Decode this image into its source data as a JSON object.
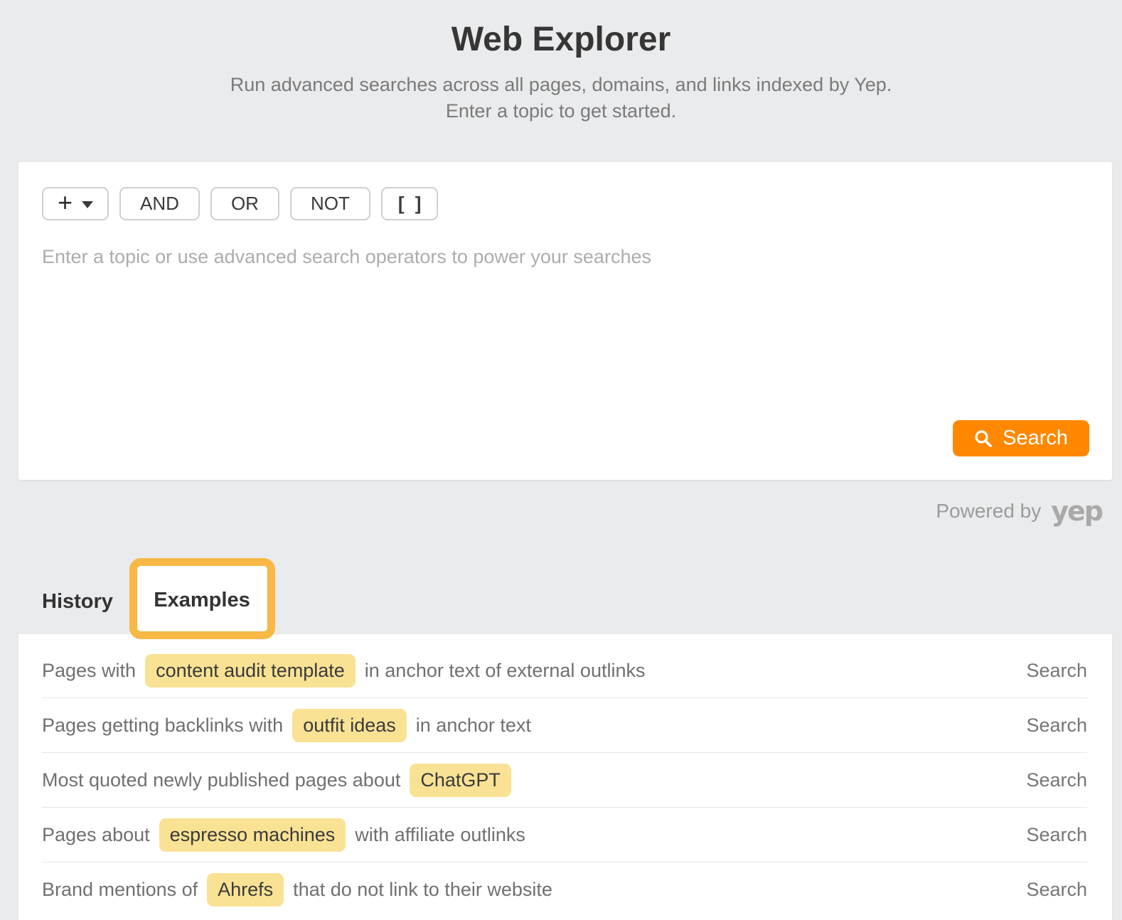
{
  "header": {
    "title": "Web Explorer",
    "subtitle_line1": "Run advanced searches across all pages, domains, and links indexed by Yep.",
    "subtitle_line2": "Enter a topic to get started."
  },
  "query_builder": {
    "add_button_label": "+",
    "operator_buttons": [
      {
        "label": "AND"
      },
      {
        "label": "OR"
      },
      {
        "label": "NOT"
      },
      {
        "label": "[ ]"
      }
    ],
    "input_placeholder": "Enter a topic or use advanced search operators to power your searches",
    "input_value": "",
    "search_button_label": "Search"
  },
  "powered_by": {
    "text": "Powered by",
    "brand": "yep"
  },
  "tabs": [
    {
      "label": "History",
      "active": false
    },
    {
      "label": "Examples",
      "active": true
    }
  ],
  "examples": {
    "rows": [
      {
        "prefix": "Pages with",
        "highlight": "content audit template",
        "suffix": "in anchor text of external outlinks",
        "action": "Search"
      },
      {
        "prefix": "Pages getting backlinks with",
        "highlight": "outfit ideas",
        "suffix": "in anchor text",
        "action": "Search"
      },
      {
        "prefix": "Most quoted newly published pages about",
        "highlight": "ChatGPT",
        "suffix": "",
        "action": "Search"
      },
      {
        "prefix": "Pages about",
        "highlight": "espresso machines",
        "suffix": "with affiliate outlinks",
        "action": "Search"
      },
      {
        "prefix": "Brand mentions of",
        "highlight": "Ahrefs",
        "suffix": "that do not link to their website",
        "action": "Search"
      }
    ]
  },
  "colors": {
    "accent_orange": "#ff8800",
    "annotation_orange": "#f7b845",
    "highlight_yellow": "#f9e294",
    "page_background": "#eaebed"
  }
}
